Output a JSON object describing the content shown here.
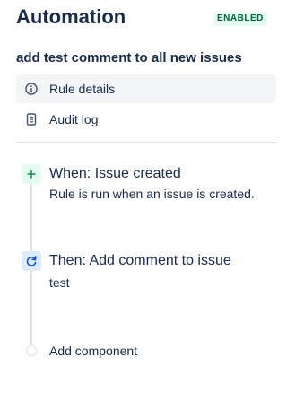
{
  "header": {
    "title": "Automation",
    "status_badge": "ENABLED"
  },
  "rule": {
    "name": "add test comment to all new issues"
  },
  "nav": {
    "items": [
      {
        "label": "Rule details",
        "icon": "info-icon",
        "active": true
      },
      {
        "label": "Audit log",
        "icon": "document-icon",
        "active": false
      }
    ]
  },
  "steps": [
    {
      "title": "When: Issue created",
      "description": "Rule is run when an issue is created.",
      "icon": "plus-icon",
      "kind": "trigger"
    },
    {
      "title": "Then: Add comment to issue",
      "description": "test",
      "icon": "refresh-icon",
      "kind": "action"
    }
  ],
  "add_component": {
    "label": "Add component"
  },
  "colors": {
    "text": "#172b4d",
    "badge_bg": "#e3fcef",
    "badge_text": "#006644",
    "trigger_bg": "#e3fcef",
    "trigger_icon": "#00875a",
    "action_bg": "#deebff",
    "action_icon": "#0052cc",
    "active_nav_bg": "#f4f5f7",
    "divider": "#dfe1e6"
  }
}
